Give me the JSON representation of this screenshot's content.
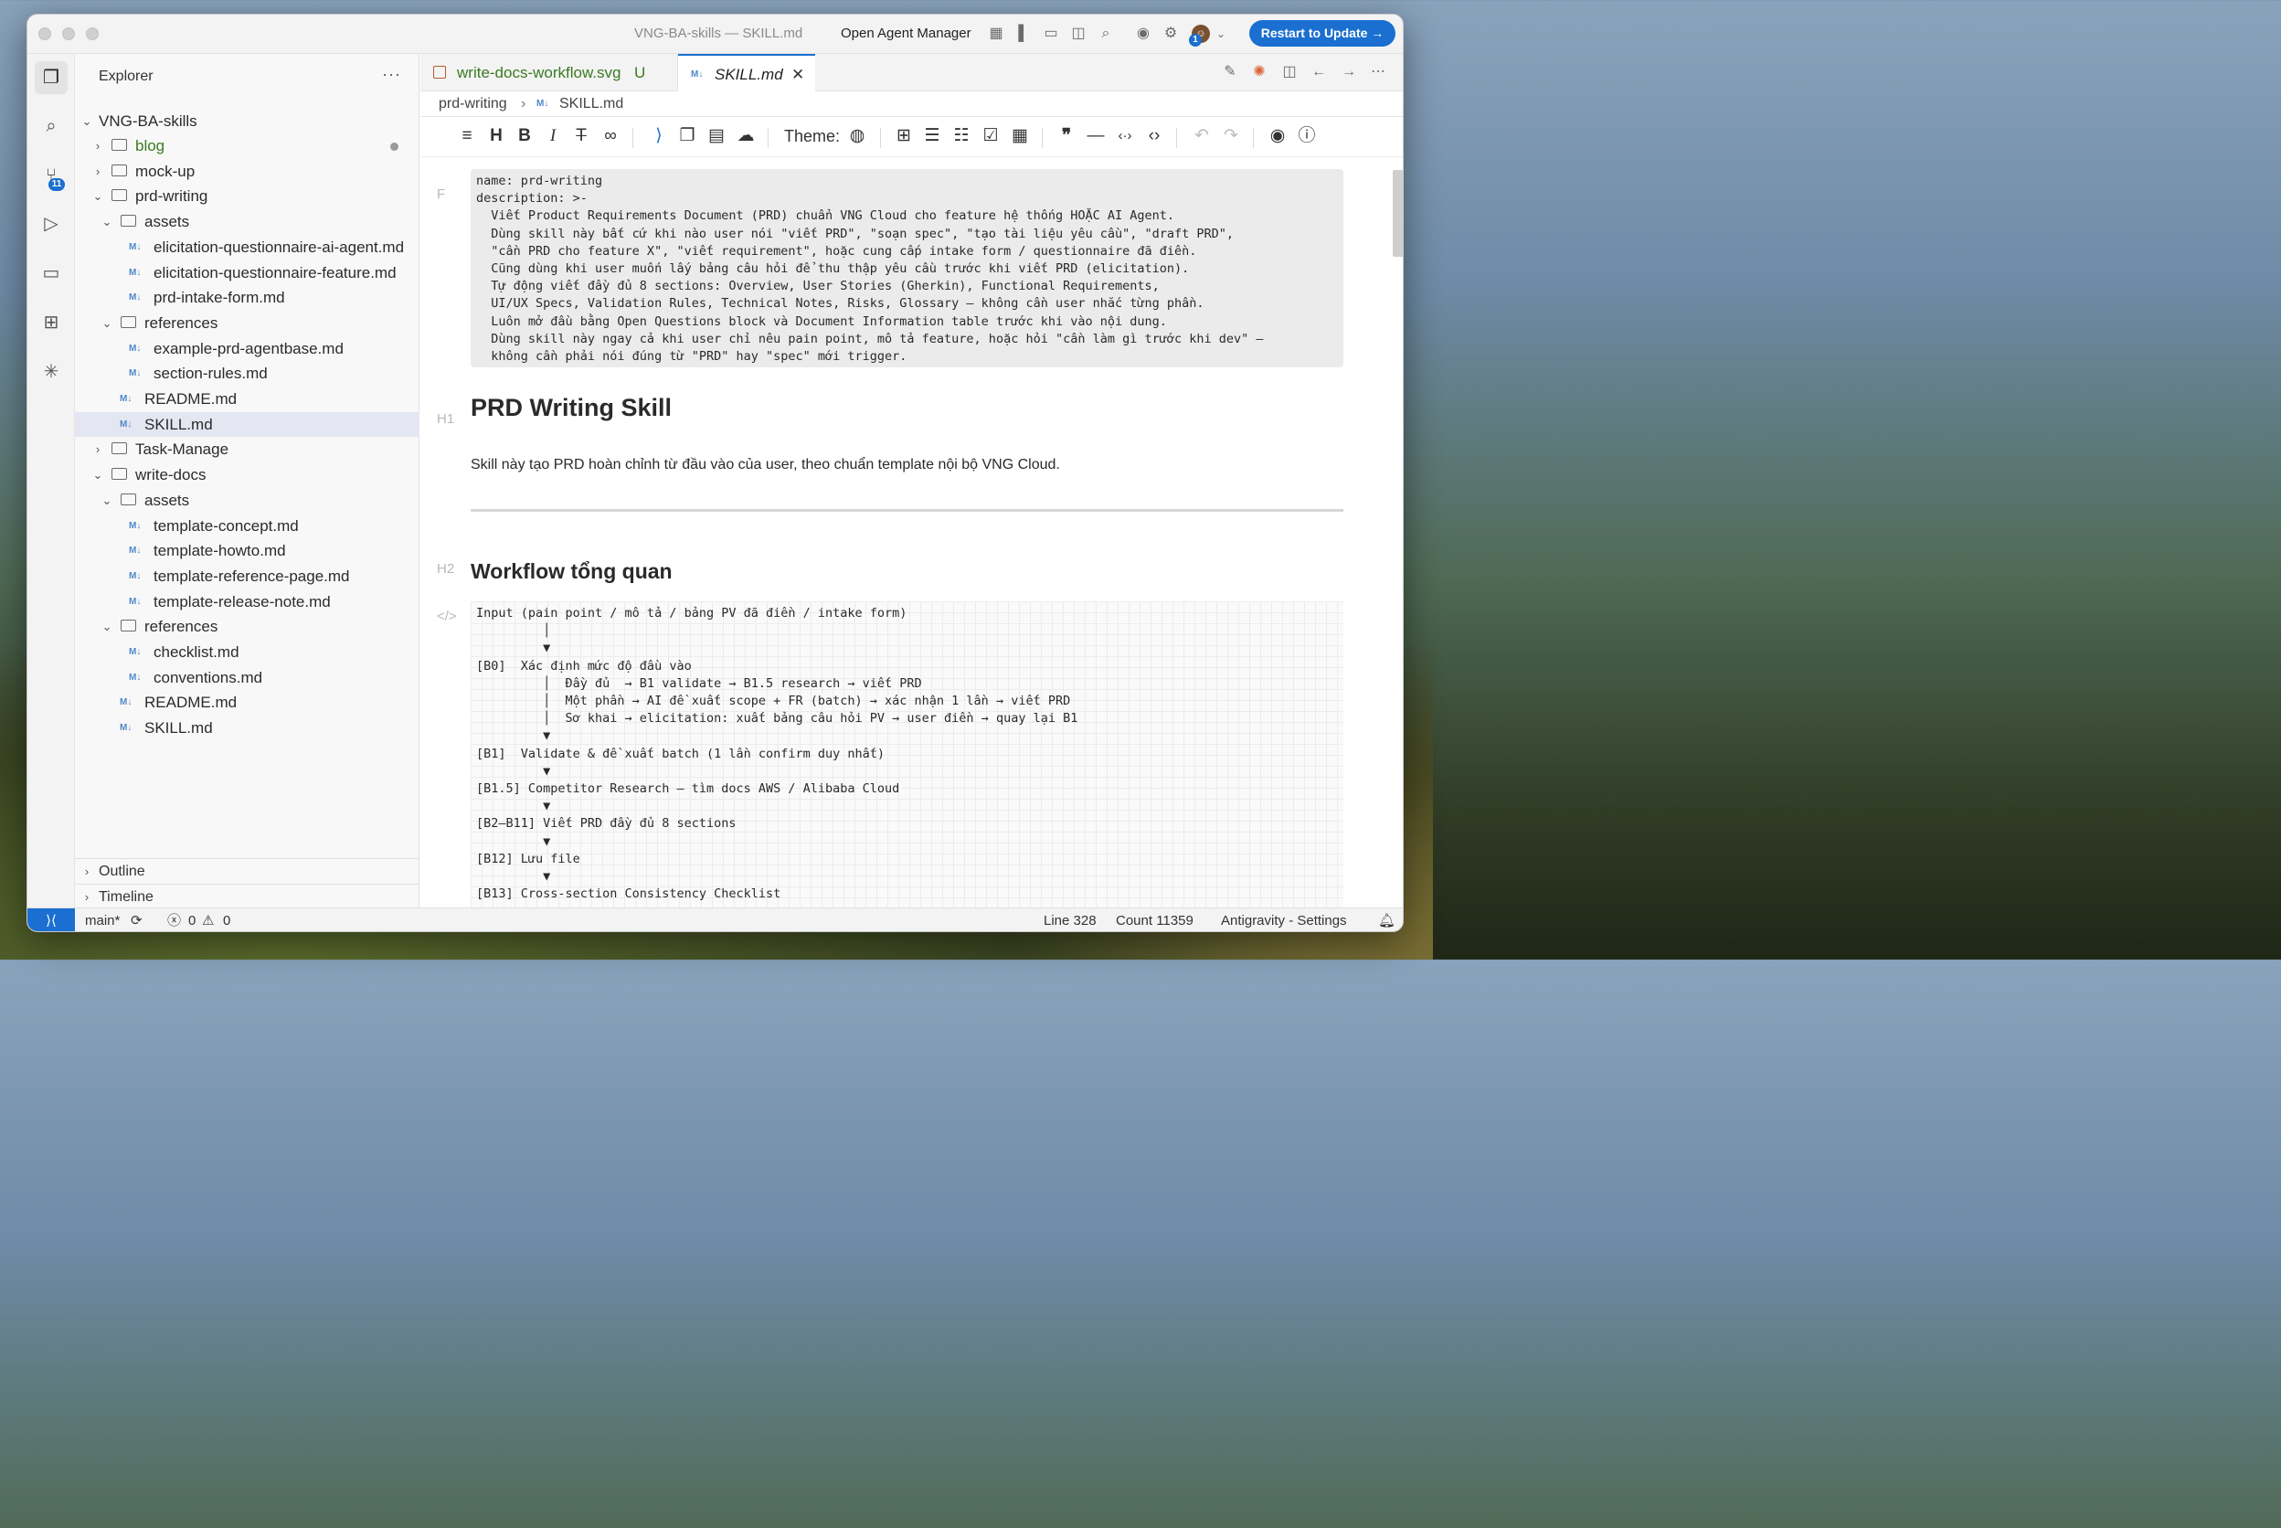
{
  "window": {
    "title": "VNG-BA-skills — SKILL.md",
    "agent_manager": "Open Agent Manager",
    "restart_button": "Restart to Update →",
    "account_badge": "1"
  },
  "activity": {
    "scm_badge": "11"
  },
  "explorer": {
    "title": "Explorer",
    "more": "···",
    "root": "VNG-BA-skills",
    "rows": [
      {
        "label": "blog",
        "kind": "folder",
        "depth": 1,
        "open": false
      },
      {
        "label": "mock-up",
        "kind": "folder",
        "depth": 1,
        "open": false
      },
      {
        "label": "prd-writing",
        "kind": "folder",
        "depth": 1,
        "open": true
      },
      {
        "label": "assets",
        "kind": "folder",
        "depth": 2,
        "open": true
      },
      {
        "label": "elicitation-questionnaire-ai-agent.md",
        "kind": "md",
        "depth": 3
      },
      {
        "label": "elicitation-questionnaire-feature.md",
        "kind": "md",
        "depth": 3
      },
      {
        "label": "prd-intake-form.md",
        "kind": "md",
        "depth": 3
      },
      {
        "label": "references",
        "kind": "folder",
        "depth": 2,
        "open": true
      },
      {
        "label": "example-prd-agentbase.md",
        "kind": "md",
        "depth": 3
      },
      {
        "label": "section-rules.md",
        "kind": "md",
        "depth": 3
      },
      {
        "label": "README.md",
        "kind": "md",
        "depth": 2
      },
      {
        "label": "SKILL.md",
        "kind": "md",
        "depth": 2
      },
      {
        "label": "Task-Manage",
        "kind": "folder",
        "depth": 1,
        "open": false
      },
      {
        "label": "write-docs",
        "kind": "folder",
        "depth": 1,
        "open": true
      },
      {
        "label": "assets",
        "kind": "folder",
        "depth": 2,
        "open": true
      },
      {
        "label": "template-concept.md",
        "kind": "md",
        "depth": 3
      },
      {
        "label": "template-howto.md",
        "kind": "md",
        "depth": 3
      },
      {
        "label": "template-reference-page.md",
        "kind": "md",
        "depth": 3
      },
      {
        "label": "template-release-note.md",
        "kind": "md",
        "depth": 3
      },
      {
        "label": "references",
        "kind": "folder",
        "depth": 2,
        "open": true
      },
      {
        "label": "checklist.md",
        "kind": "md",
        "depth": 3
      },
      {
        "label": "conventions.md",
        "kind": "md",
        "depth": 3
      },
      {
        "label": "README.md",
        "kind": "md",
        "depth": 2
      },
      {
        "label": "SKILL.md",
        "kind": "md",
        "depth": 2
      }
    ],
    "outline": "Outline",
    "timeline": "Timeline"
  },
  "tabs": [
    {
      "label": "write-docs-workflow.svg",
      "status": "U"
    },
    {
      "label": "SKILL.md"
    }
  ],
  "breadcrumb": {
    "folder": "prd-writing",
    "file": "SKILL.md"
  },
  "toolbar": {
    "theme_label": "Theme:"
  },
  "editor": {
    "gutter_frontmatter": "F",
    "gutter_h1": "H1",
    "gutter_h2": "H2",
    "gutter_code": "</>",
    "frontmatter": "name: prd-writing\ndescription: >-\n  Viết Product Requirements Document (PRD) chuẩn VNG Cloud cho feature hệ thống HOẶC AI Agent.\n  Dùng skill này bất cứ khi nào user nói \"viết PRD\", \"soạn spec\", \"tạo tài liệu yêu cầu\", \"draft PRD\",\n  \"cần PRD cho feature X\", \"viết requirement\", hoặc cung cấp intake form / questionnaire đã điền.\n  Cũng dùng khi user muốn lấy bảng câu hỏi để thu thập yêu cầu trước khi viết PRD (elicitation).\n  Tự động viết đầy đủ 8 sections: Overview, User Stories (Gherkin), Functional Requirements,\n  UI/UX Specs, Validation Rules, Technical Notes, Risks, Glossary — không cần user nhắc từng phần.\n  Luôn mở đầu bằng Open Questions block và Document Information table trước khi vào nội dung.\n  Dùng skill này ngay cả khi user chỉ nêu pain point, mô tả feature, hoặc hỏi \"cần làm gì trước khi dev\" —\n  không cần phải nói đúng từ \"PRD\" hay \"spec\" mới trigger.",
    "h1": "PRD Writing Skill",
    "paragraph": "Skill này tạo PRD hoàn chỉnh từ đầu vào của user, theo chuẩn template nội bộ VNG Cloud.",
    "h2": "Workflow tổng quan",
    "code": "Input (pain point / mô tả / bảng PV đã điền / intake form)\n         │\n         ▼\n[B0]  Xác định mức độ đầu vào\n         │  Đầy đủ  → B1 validate → B1.5 research → viết PRD\n         │  Một phần → AI đề xuất scope + FR (batch) → xác nhận 1 lần → viết PRD\n         │  Sơ khai → elicitation: xuất bảng câu hỏi PV → user điền → quay lại B1\n         ▼\n[B1]  Validate & đề xuất batch (1 lần confirm duy nhất)\n         ▼\n[B1.5] Competitor Research — tìm docs AWS / Alibaba Cloud\n         ▼\n[B2–B11] Viết PRD đầy đủ 8 sections\n         ▼\n[B12] Lưu file\n         ▼\n[B13] Cross-section Consistency Checklist\n         ▼"
  },
  "status": {
    "branch": "main*",
    "errors": "0",
    "warnings": "0",
    "line": "Line 328",
    "count": "Count 11359",
    "settings": "Antigravity - Settings"
  }
}
